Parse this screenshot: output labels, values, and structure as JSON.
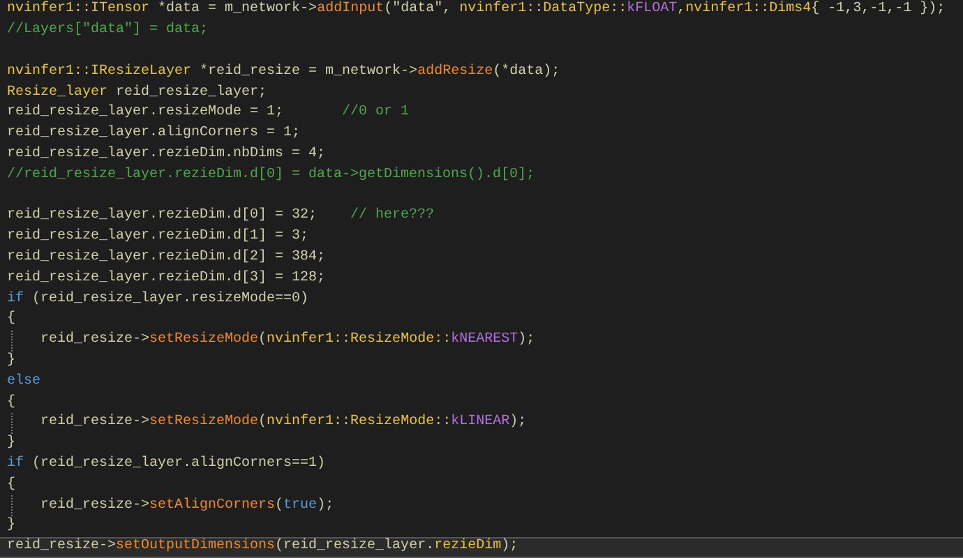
{
  "editor": {
    "lines": [
      {
        "current": false,
        "tokens": [
          {
            "kind": "type",
            "text": "nvinfer1::ITensor"
          },
          {
            "kind": "plain",
            "text": " *data = m_network->"
          },
          {
            "kind": "func",
            "text": "addInput"
          },
          {
            "kind": "plain",
            "text": "(\"data\", "
          },
          {
            "kind": "type",
            "text": "nvinfer1::DataType::"
          },
          {
            "kind": "const",
            "text": "kFLOAT"
          },
          {
            "kind": "plain",
            "text": ","
          },
          {
            "kind": "type",
            "text": "nvinfer1::Dims4"
          },
          {
            "kind": "plain",
            "text": "{ -1,3,-1,-1 });"
          }
        ]
      },
      {
        "current": false,
        "tokens": [
          {
            "kind": "comment",
            "text": "//Layers[\"data\"] = data;"
          }
        ]
      },
      {
        "current": false
      },
      {
        "current": false,
        "tokens": [
          {
            "kind": "type",
            "text": "nvinfer1::IResizeLayer"
          },
          {
            "kind": "plain",
            "text": " *reid_resize = m_network->"
          },
          {
            "kind": "func",
            "text": "addResize"
          },
          {
            "kind": "plain",
            "text": "(*data);"
          }
        ]
      },
      {
        "current": false,
        "tokens": [
          {
            "kind": "type",
            "text": "Resize_layer"
          },
          {
            "kind": "plain",
            "text": " reid_resize_layer;"
          }
        ]
      },
      {
        "current": false,
        "tokens": [
          {
            "kind": "plain",
            "text": "reid_resize_layer.resizeMode = 1;       "
          },
          {
            "kind": "comment",
            "text": "//0 or 1"
          }
        ]
      },
      {
        "current": false,
        "tokens": [
          {
            "kind": "plain",
            "text": "reid_resize_layer.alignCorners = 1;"
          }
        ]
      },
      {
        "current": false,
        "tokens": [
          {
            "kind": "plain",
            "text": "reid_resize_layer.rezieDim.nbDims = 4;"
          }
        ]
      },
      {
        "current": false,
        "tokens": [
          {
            "kind": "comment",
            "text": "//reid_resize_layer.rezieDim.d[0] = data->getDimensions().d[0];"
          }
        ]
      },
      {
        "current": false
      },
      {
        "current": false,
        "tokens": [
          {
            "kind": "plain",
            "text": "reid_resize_layer.rezieDim.d[0] = 32;    "
          },
          {
            "kind": "comment",
            "text": "// here???"
          }
        ]
      },
      {
        "current": false,
        "tokens": [
          {
            "kind": "plain",
            "text": "reid_resize_layer.rezieDim.d[1] = 3;"
          }
        ]
      },
      {
        "current": false,
        "tokens": [
          {
            "kind": "plain",
            "text": "reid_resize_layer.rezieDim.d[2] = 384;"
          }
        ]
      },
      {
        "current": false,
        "tokens": [
          {
            "kind": "plain",
            "text": "reid_resize_layer.rezieDim.d[3] = 128;"
          }
        ]
      },
      {
        "current": false,
        "tokens": [
          {
            "kind": "keyword",
            "text": "if"
          },
          {
            "kind": "plain",
            "text": " (reid_resize_layer.resizeMode==0)"
          }
        ]
      },
      {
        "current": false,
        "tokens": [
          {
            "kind": "plain",
            "text": "{"
          }
        ]
      },
      {
        "current": false,
        "indented": true,
        "tokens": [
          {
            "kind": "plain",
            "text": "reid_resize->"
          },
          {
            "kind": "func",
            "text": "setResizeMode"
          },
          {
            "kind": "plain",
            "text": "("
          },
          {
            "kind": "type",
            "text": "nvinfer1::ResizeMode::"
          },
          {
            "kind": "const",
            "text": "kNEAREST"
          },
          {
            "kind": "plain",
            "text": ");"
          }
        ]
      },
      {
        "current": false,
        "tokens": [
          {
            "kind": "plain",
            "text": "}"
          }
        ]
      },
      {
        "current": false,
        "tokens": [
          {
            "kind": "keyword",
            "text": "else"
          }
        ]
      },
      {
        "current": false,
        "tokens": [
          {
            "kind": "plain",
            "text": "{"
          }
        ]
      },
      {
        "current": false,
        "indented": true,
        "tokens": [
          {
            "kind": "plain",
            "text": "reid_resize->"
          },
          {
            "kind": "func",
            "text": "setResizeMode"
          },
          {
            "kind": "plain",
            "text": "("
          },
          {
            "kind": "type",
            "text": "nvinfer1::ResizeMode::"
          },
          {
            "kind": "const",
            "text": "kLINEAR"
          },
          {
            "kind": "plain",
            "text": ");"
          }
        ]
      },
      {
        "current": false,
        "tokens": [
          {
            "kind": "plain",
            "text": "}"
          }
        ]
      },
      {
        "current": false,
        "tokens": [
          {
            "kind": "keyword",
            "text": "if"
          },
          {
            "kind": "plain",
            "text": " (reid_resize_layer.alignCorners==1)"
          }
        ]
      },
      {
        "current": false,
        "tokens": [
          {
            "kind": "plain",
            "text": "{"
          }
        ]
      },
      {
        "current": false,
        "indented": true,
        "tokens": [
          {
            "kind": "plain",
            "text": "reid_resize->"
          },
          {
            "kind": "func",
            "text": "setAlignCorners"
          },
          {
            "kind": "plain",
            "text": "("
          },
          {
            "kind": "keyword",
            "text": "true"
          },
          {
            "kind": "plain",
            "text": ");"
          }
        ]
      },
      {
        "current": false,
        "tokens": [
          {
            "kind": "plain",
            "text": "}"
          }
        ]
      },
      {
        "current": true,
        "tokens": [
          {
            "kind": "plain",
            "text": "reid_resize->"
          },
          {
            "kind": "func",
            "text": "setOutputDimensions"
          },
          {
            "kind": "plain",
            "text": "(reid_resize_layer."
          },
          {
            "kind": "type",
            "text": "rezieDim"
          },
          {
            "kind": "plain",
            "text": ");"
          }
        ]
      }
    ]
  }
}
